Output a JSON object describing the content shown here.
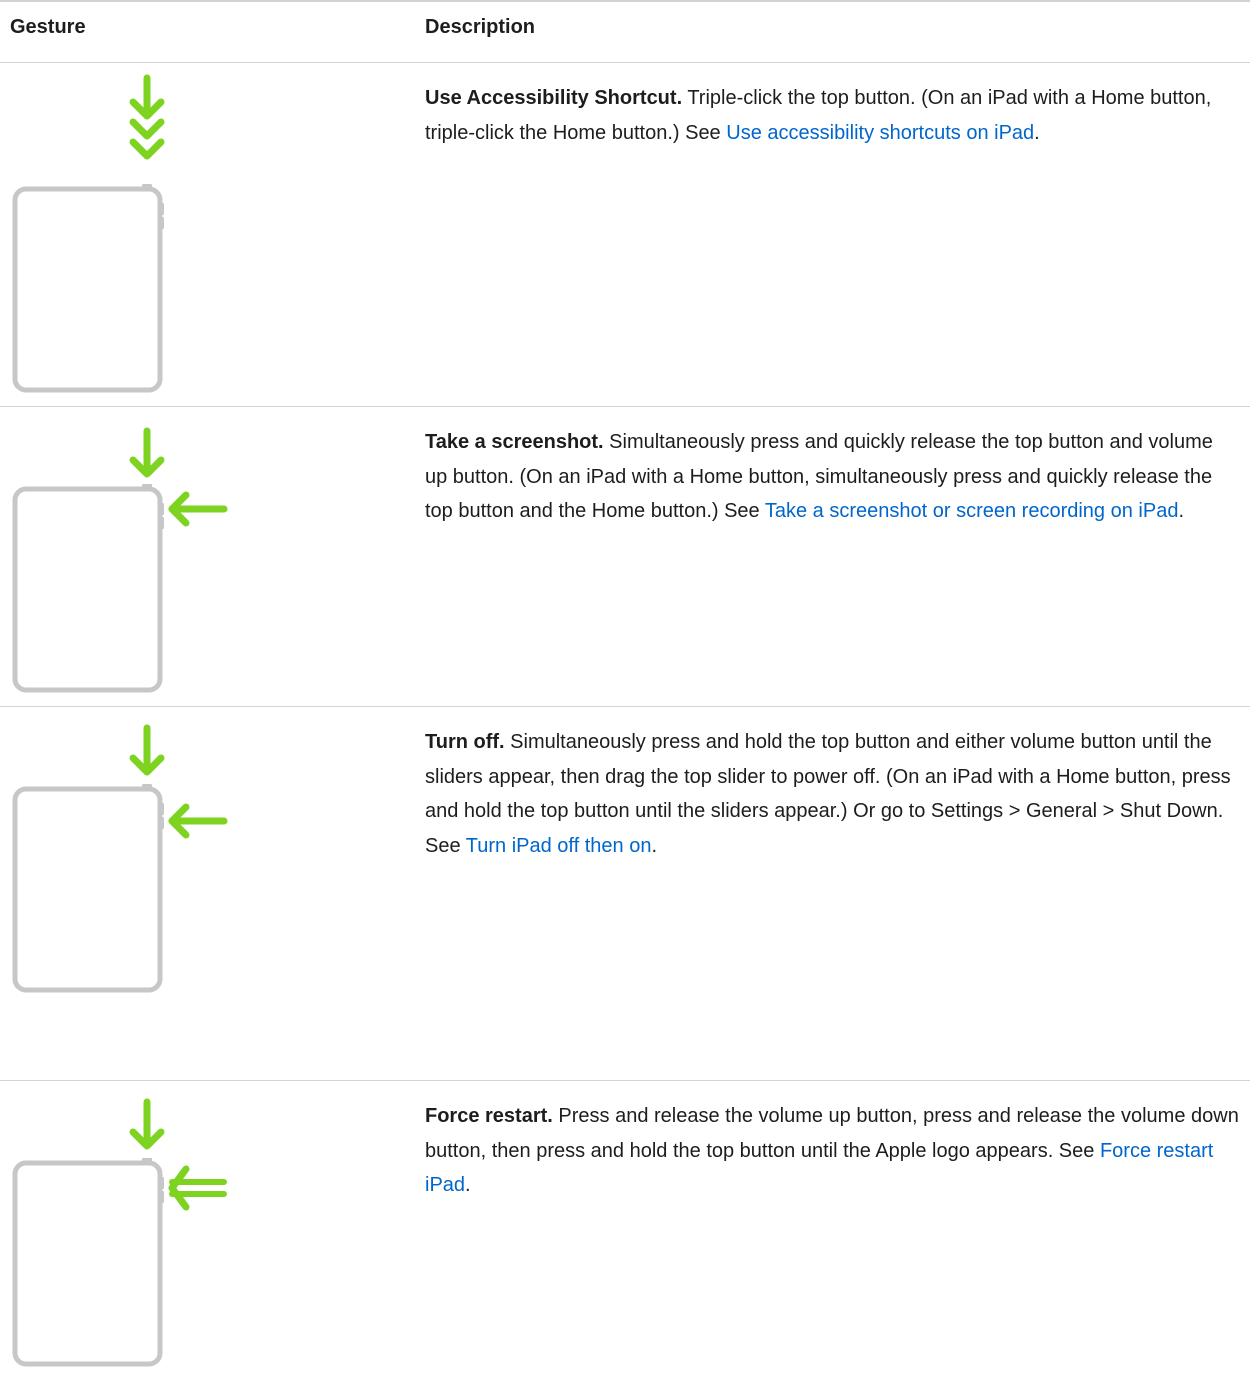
{
  "header": {
    "gesture_label": "Gesture",
    "description_label": "Description"
  },
  "colors": {
    "arrow": "#7ed321",
    "ipad_outline": "#c7c7c9",
    "link": "#0066cc",
    "rule": "#d2d2d7"
  },
  "rows": [
    {
      "icon": "triple-down-arrow-top-button-icon",
      "title": "Use Accessibility Shortcut.",
      "text": " Triple-click the top button. (On an iPad with a Home button, triple-click the Home button.) See ",
      "link": "Use accessibility shortcuts on iPad",
      "end": "."
    },
    {
      "icon": "top-and-volume-up-arrows-icon",
      "title": "Take a screenshot.",
      "text": " Simultaneously press and quickly release the top button and volume up button. (On an iPad with a Home button, simultaneously press and quickly release the top button and the Home button.) See ",
      "link": "Take a screenshot or screen recording on iPad",
      "end": "."
    },
    {
      "icon": "top-and-volume-arrows-icon",
      "title": "Turn off.",
      "text": " Simultaneously press and hold the top button and either volume button until the sliders appear, then drag the top slider to power off. (On an iPad with a Home button, press and hold the top button until the sliders appear.) Or go to Settings > General > Shut Down. See ",
      "link": "Turn iPad off then on",
      "end": "."
    },
    {
      "icon": "top-and-volume-double-arrows-icon",
      "title": "Force restart.",
      "text": " Press and release the volume up button, press and release the volume down button, then press and hold the top button until the Apple logo appears. See ",
      "link": "Force restart iPad",
      "end": "."
    }
  ]
}
